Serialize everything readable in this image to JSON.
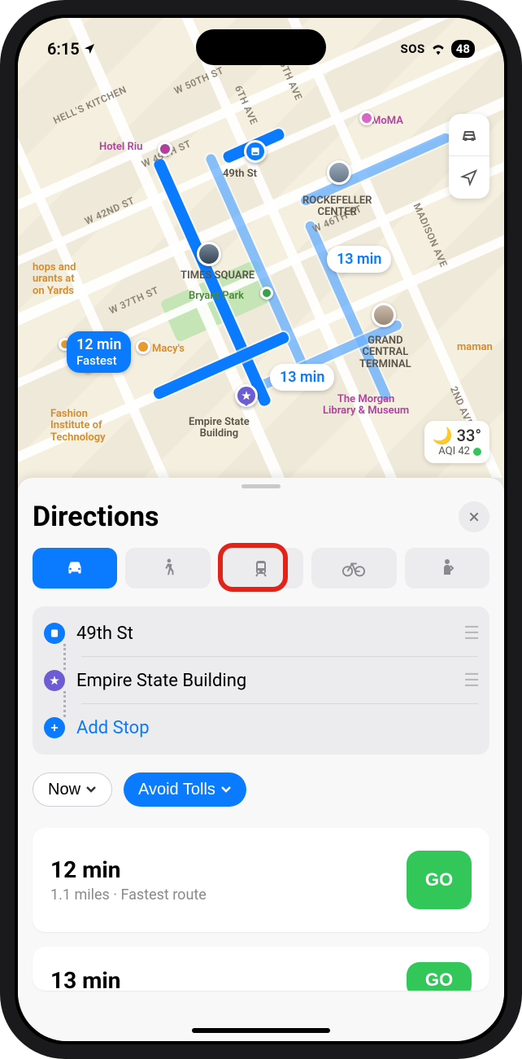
{
  "status": {
    "time": "6:15",
    "sos": "SOS",
    "battery": "48"
  },
  "map": {
    "areas": {
      "hells_kitchen": "HELL'S KITCHEN"
    },
    "streets": {
      "w50": "W 50TH ST",
      "w49": "W 49TH ST",
      "ave6": "6TH AVE",
      "w42": "W 42ND ST",
      "w37": "W 37TH ST",
      "w46": "W 46TH ST",
      "ave5": "5TH AVE",
      "madison": "MADISON AVE",
      "ave2": "2ND AVE"
    },
    "labels": {
      "moma": "MoMA",
      "hotel_riu": "Hotel Riu",
      "times_square": "TIMES SQUARE",
      "bryant_park": "Bryant Park",
      "rockefeller": "ROCKEFELLER\nCENTER",
      "macys": "Macy's",
      "morgan": "The Morgan\nLibrary & Museum",
      "fit": "Fashion\nInstitute of\nTechnology",
      "shops": "hops and\nurants at\non Yards",
      "esb": "Empire State\nBuilding",
      "grand_central": "GRAND\nCENTRAL\nTERMINAL",
      "maman": "maman",
      "fortyninth": "49th St"
    },
    "route_labels": {
      "primary_time": "12 min",
      "primary_sub": "Fastest",
      "alt1": "13 min",
      "alt2": "13 min"
    },
    "weather": {
      "temp": "33°",
      "aqi": "AQI 42"
    }
  },
  "panel": {
    "title": "Directions",
    "modes": [
      "drive",
      "walk",
      "transit",
      "cycle",
      "rideshare"
    ],
    "active_mode_index": 0,
    "stops": [
      {
        "label": "49th St",
        "kind": "start"
      },
      {
        "label": "Empire State Building",
        "kind": "dest"
      }
    ],
    "add_stop": "Add Stop",
    "filters": {
      "time": "Now",
      "avoid": "Avoid Tolls"
    },
    "routes": [
      {
        "time": "12 min",
        "sub": "1.1 miles · Fastest route",
        "go": "GO"
      },
      {
        "time": "13 min",
        "sub": "",
        "go": "GO"
      }
    ]
  }
}
